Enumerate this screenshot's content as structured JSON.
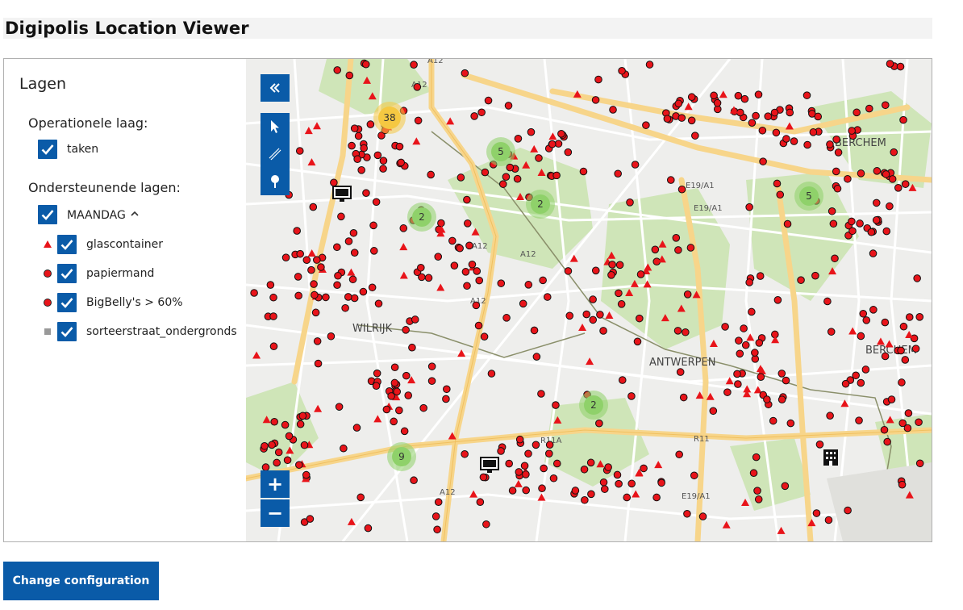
{
  "app": {
    "title": "Digipolis Location Viewer"
  },
  "layers_panel": {
    "title": "Lagen",
    "operational_title": "Operationele laag:",
    "operational_layers": [
      {
        "label": "taken",
        "checked": true
      }
    ],
    "supporting_title": "Ondersteunende lagen:",
    "group": {
      "label": "MAANDAG",
      "checked": true,
      "expanded": true,
      "chevron": "chevron-up-icon"
    },
    "sublayers": [
      {
        "label": "glascontainer",
        "symbol": "red-triangle",
        "checked": true
      },
      {
        "label": "papiermand",
        "symbol": "red-circle",
        "checked": true
      },
      {
        "label": "BigBelly's > 60%",
        "symbol": "red-circle",
        "checked": true
      },
      {
        "label": "sorteerstraat_ondergronds",
        "symbol": "grey-square",
        "checked": true
      }
    ]
  },
  "map": {
    "place_labels": [
      "BERCHEM",
      "WILRIJK",
      "ANTWERPEN",
      "BERCHEM"
    ],
    "road_labels": [
      "A12",
      "A12",
      "A12",
      "A12",
      "A12",
      "A12",
      "E19/A1",
      "E19/A1",
      "R11A",
      "R11",
      "E19/A1"
    ],
    "clusters": [
      {
        "count": "38",
        "color": "yellow"
      },
      {
        "count": "5",
        "color": "green"
      },
      {
        "count": "2",
        "color": "green"
      },
      {
        "count": "2",
        "color": "green"
      },
      {
        "count": "5",
        "color": "green"
      },
      {
        "count": "2",
        "color": "green"
      },
      {
        "count": "9",
        "color": "green"
      }
    ],
    "tools": {
      "collapse": "double-chevron-left-icon",
      "select": "cursor-arrow-icon",
      "measure": "ruler-icon",
      "location": "location-pin-icon",
      "zoom_in": "+",
      "zoom_out": "−"
    }
  },
  "actions": {
    "change_configuration": "Change configuration"
  },
  "colors": {
    "accent": "#0a5ba8",
    "marker": "#e8141a",
    "cluster_green": "#8fd16a",
    "cluster_yellow": "#f5c842"
  }
}
